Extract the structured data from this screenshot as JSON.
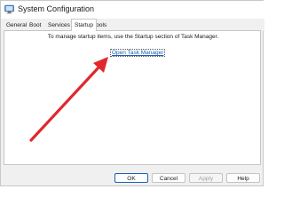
{
  "window": {
    "title": "System Configuration"
  },
  "tabs": [
    {
      "label": "General"
    },
    {
      "label": "Boot"
    },
    {
      "label": "Services"
    },
    {
      "label": "Startup"
    },
    {
      "label": "Tools"
    }
  ],
  "active_tab": "Startup",
  "startup": {
    "info": "To manage startup items, use the Startup section of Task Manager.",
    "link": "Open Task Manager"
  },
  "buttons": {
    "ok": "OK",
    "cancel": "Cancel",
    "apply": "Apply",
    "help": "Help"
  },
  "annotation": {
    "arrow_color": "#e0282c"
  },
  "icons": [
    "system-configuration-icon"
  ]
}
